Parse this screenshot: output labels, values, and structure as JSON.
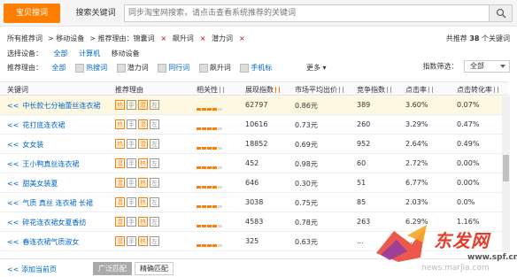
{
  "tabs": [
    "宝贝搜词",
    "搜索关键词"
  ],
  "search": {
    "placeholder": "同步淘宝网搜索，请点击查看系统推荐的关键词"
  },
  "filter": {
    "breadcrumb": [
      "所有推荐词",
      "移动设备",
      "推荐理由：锦囊词",
      "飙升词",
      "潜力词"
    ],
    "total_prefix": "共推荐",
    "total_count": "38",
    "total_suffix": "个关键词",
    "device_label": "选择设备：",
    "device_options": [
      "全部",
      "计算机",
      "移动设备"
    ],
    "reason_label": "推荐理由：",
    "reason_options": [
      "全部",
      "热搜词",
      "潜力词",
      "同行词",
      "飙升词",
      "手机标"
    ],
    "more": "更多",
    "sort_label": "指数筛选：",
    "sort_value": "全部"
  },
  "table": {
    "headers": [
      "关键词",
      "推荐理由",
      "相关性",
      "展现指数",
      "市场平均出价",
      "竞争指数",
      "点击率",
      "点击转化率"
    ],
    "rows": [
      {
        "keyword": "中长款七分袖蕾丝连衣裙",
        "reasons": [
          "热",
          "手",
          "潜",
          "左"
        ],
        "rel": 4,
        "show": "62797",
        "price": "0.86元",
        "comp": "389",
        "ctr": "3.60%",
        "cvr": "0.07%"
      },
      {
        "keyword": "花打底连衣裙",
        "reasons": [
          "热",
          "手",
          "潜",
          "左"
        ],
        "rel": 4,
        "show": "10616",
        "price": "0.73元",
        "comp": "260",
        "ctr": "3.29%",
        "cvr": "0.47%"
      },
      {
        "keyword": "女女装",
        "reasons": [
          "热",
          "手",
          "潜",
          "左"
        ],
        "rel": 4,
        "show": "18852",
        "price": "0.69元",
        "comp": "952",
        "ctr": "2.64%",
        "cvr": "0.49%"
      },
      {
        "keyword": "王小鸭真丝连衣裙",
        "reasons": [
          "潜",
          "手",
          "热",
          "左"
        ],
        "rel": 4,
        "show": "452",
        "price": "0.98元",
        "comp": "60",
        "ctr": "2.72%",
        "cvr": "0.00%"
      },
      {
        "keyword": "甜美女装夏",
        "reasons": [
          "潜",
          "手",
          "热",
          "左"
        ],
        "rel": 4,
        "show": "646",
        "price": "0.30元",
        "comp": "51",
        "ctr": "6.77%",
        "cvr": "0.00%"
      },
      {
        "keyword": "气质 真丝 连衣裙 长裙",
        "reasons": [
          "潜",
          "手",
          "热",
          "左"
        ],
        "rel": 4,
        "show": "3038",
        "price": "0.75元",
        "comp": "85",
        "ctr": "2.03%",
        "cvr": "0.0%"
      },
      {
        "keyword": "碎花连衣裙女夏香纺",
        "reasons": [
          "潜",
          "手",
          "热",
          "左"
        ],
        "rel": 4,
        "show": "4583",
        "price": "0.78元",
        "comp": "263",
        "ctr": "6.29%",
        "cvr": "1.16%"
      },
      {
        "keyword": "春连衣裙气质淑女",
        "reasons": [
          "潜",
          "手",
          "热",
          "左"
        ],
        "rel": 4,
        "show": "325",
        "price": "0.63元",
        "comp": "...",
        "ctr": "...",
        "cvr": "..."
      }
    ]
  },
  "footer": {
    "add_label": "添加当前页",
    "btn_broad": "广泛匹配",
    "btn_exact": "精确匹配"
  },
  "watermark": {
    "brand": "东发网",
    "url": "www.spf.cn",
    "url2": "news.marjia.com"
  }
}
